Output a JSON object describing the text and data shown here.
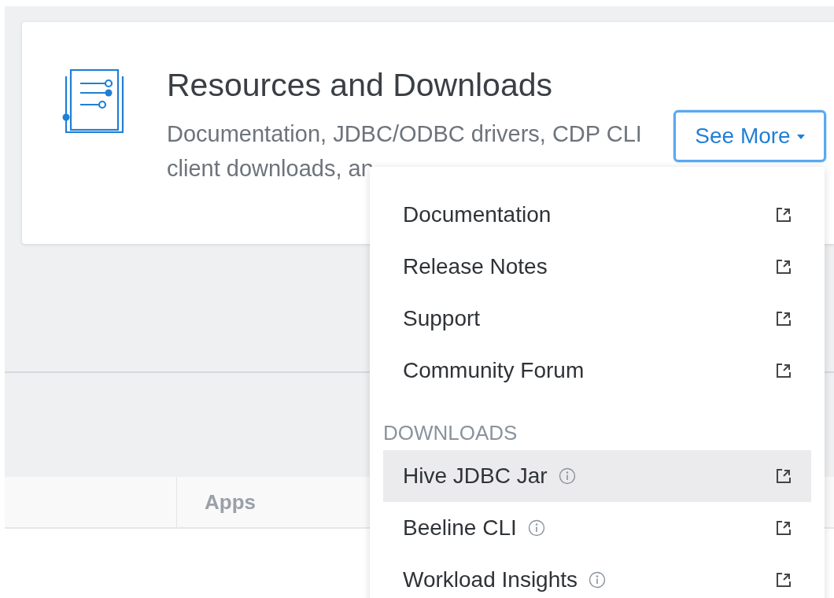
{
  "card": {
    "title": "Resources and Downloads",
    "description": "Documentation, JDBC/ODBC drivers, CDP CLI client downloads, an",
    "see_more": {
      "label": "See More",
      "expanded": true
    }
  },
  "table": {
    "columns": [
      {
        "label": "Apps"
      }
    ]
  },
  "dropdown": {
    "items": [
      {
        "kind": "link",
        "label": "Documentation",
        "info": false,
        "selected": false
      },
      {
        "kind": "link",
        "label": "Release Notes",
        "info": false,
        "selected": false
      },
      {
        "kind": "link",
        "label": "Support",
        "info": false,
        "selected": false
      },
      {
        "kind": "link",
        "label": "Community Forum",
        "info": false,
        "selected": false
      },
      {
        "kind": "header",
        "label": "DOWNLOADS"
      },
      {
        "kind": "link",
        "label": "Hive JDBC Jar",
        "info": true,
        "selected": true
      },
      {
        "kind": "link",
        "label": "Beeline CLI",
        "info": true,
        "selected": false
      },
      {
        "kind": "link",
        "label": "Workload Insights",
        "info": true,
        "selected": false
      }
    ]
  }
}
